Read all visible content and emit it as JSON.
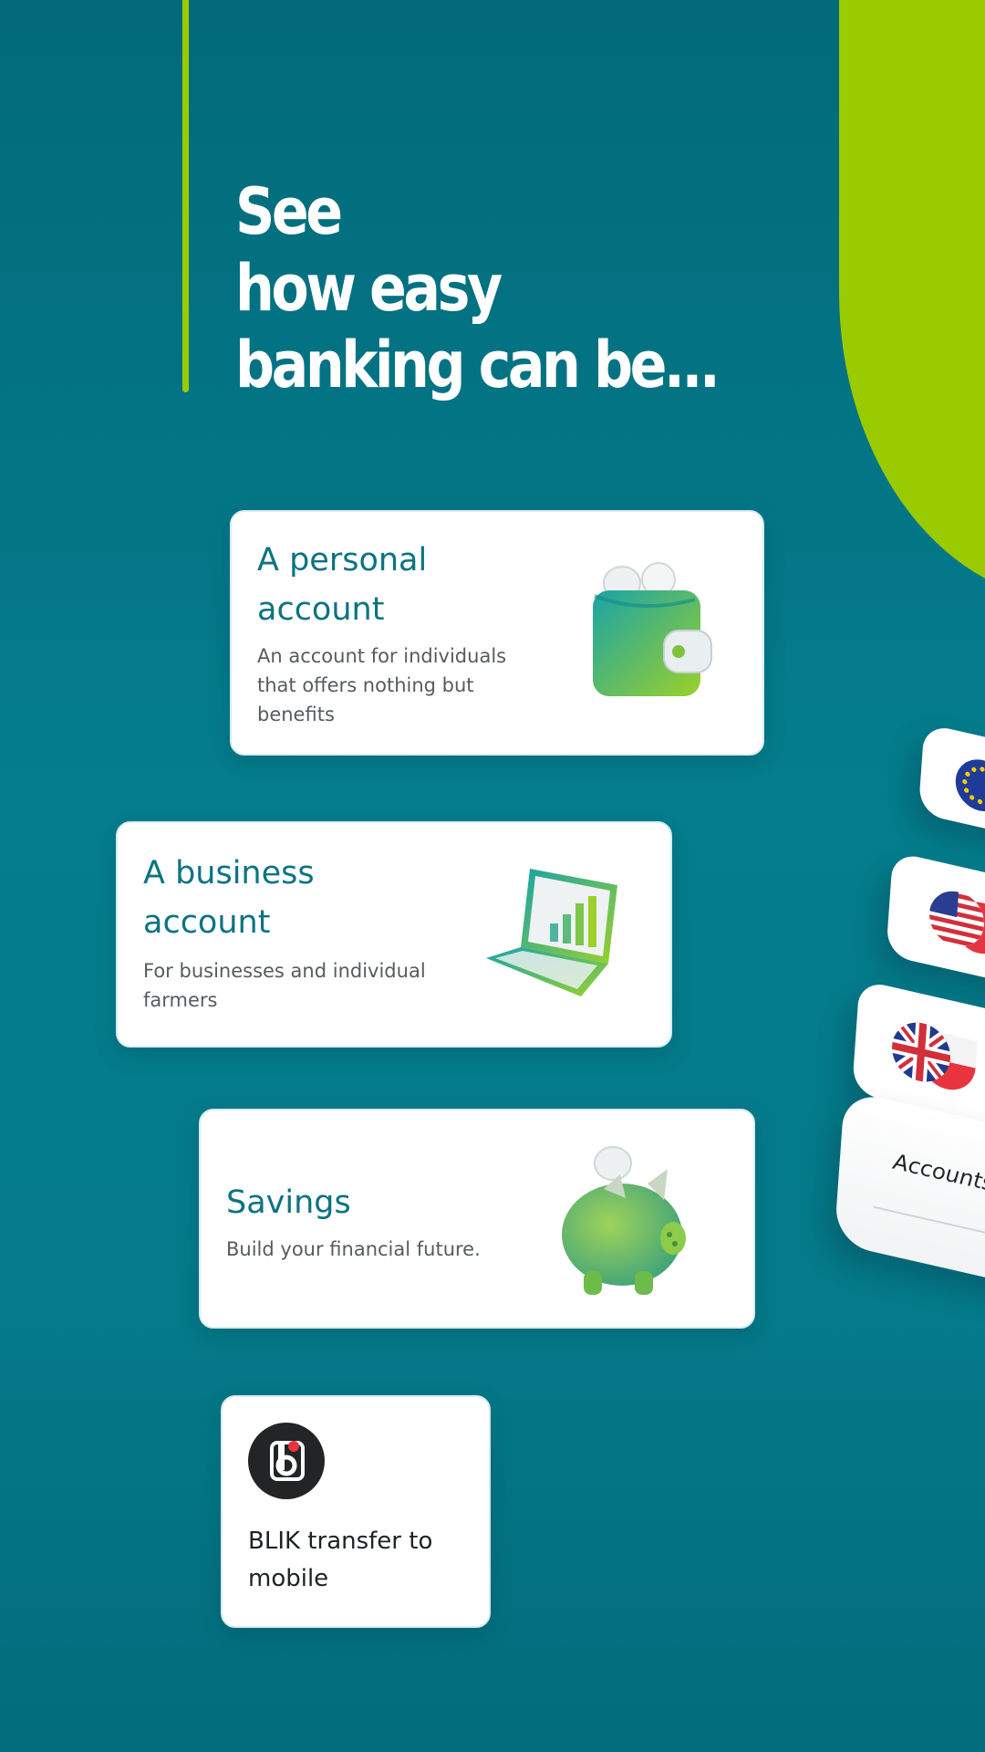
{
  "headline": {
    "line1": "See",
    "line2": "how easy",
    "line3": "banking can be..."
  },
  "cards": {
    "personal": {
      "title": "A personal account",
      "description": "An account for individuals that offers nothing but benefits",
      "icon": "wallet-icon"
    },
    "business": {
      "title": "A business account",
      "description": "For businesses and individual farmers",
      "icon": "laptop-chart-icon"
    },
    "savings": {
      "title": "Savings",
      "description": "Build your financial future.",
      "icon": "piggy-bank-icon"
    },
    "blik": {
      "title": "BLIK transfer to mobile",
      "icon": "blik-logo-icon"
    }
  },
  "accounts_stack": {
    "label": "Accounts",
    "currencies": [
      "eu-flag-icon",
      "us-flag-icon",
      "uk-flag-icon"
    ]
  },
  "colors": {
    "background": "#047d8d",
    "accent": "#99cc00",
    "card_title": "#0b7383",
    "card_text": "#555c60"
  }
}
